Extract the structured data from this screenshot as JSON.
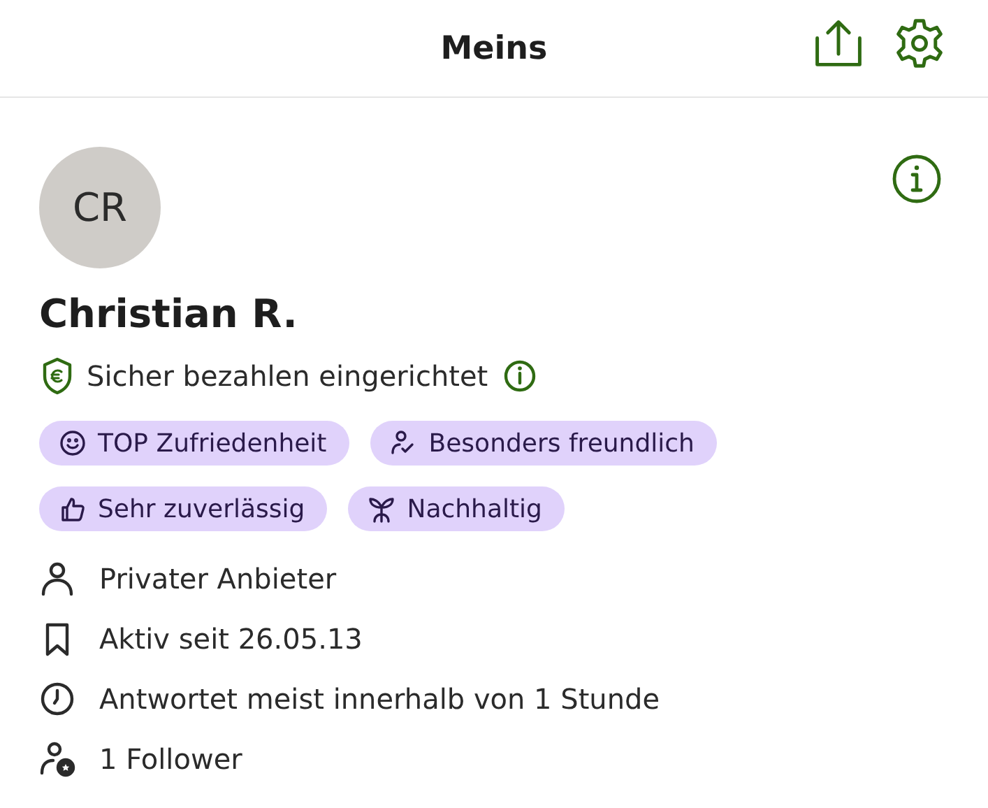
{
  "header": {
    "title": "Meins"
  },
  "profile": {
    "initials": "CR",
    "name": "Christian R.",
    "payment": "Sicher bezahlen eingerichtet"
  },
  "badges": [
    {
      "kind": "smile",
      "label": "TOP Zufriedenheit"
    },
    {
      "kind": "friendly",
      "label": "Besonders freundlich"
    },
    {
      "kind": "thumb",
      "label": "Sehr zuverlässig"
    },
    {
      "kind": "plant",
      "label": "Nachhaltig"
    }
  ],
  "details": [
    {
      "kind": "person",
      "text": "Privater Anbieter"
    },
    {
      "kind": "bookmark",
      "text": "Aktiv seit 26.05.13"
    },
    {
      "kind": "clock",
      "text": "Antwortet meist innerhalb von 1 Stunde"
    },
    {
      "kind": "follower",
      "text": "1 Follower"
    }
  ]
}
